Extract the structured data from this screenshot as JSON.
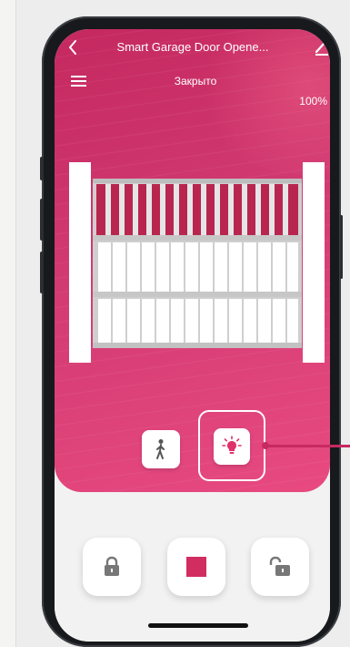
{
  "app": {
    "title": "Smart Garage Door Opene...",
    "status": "Закрыто",
    "percent": "100%"
  },
  "icons": {
    "back": "chevron-left-icon",
    "edit": "edit-icon",
    "menu": "hamburger-menu-icon",
    "pedestrian": "walking-person-icon",
    "light": "light-bulb-icon",
    "close": "lock-closed-icon",
    "stop": "stop-icon",
    "open": "lock-open-icon"
  },
  "colors": {
    "accent": "#c72a62",
    "hero_top": "#c4285f",
    "hero_bottom": "#e84a80",
    "stop": "#d12d61",
    "icon_gray": "#777777"
  }
}
